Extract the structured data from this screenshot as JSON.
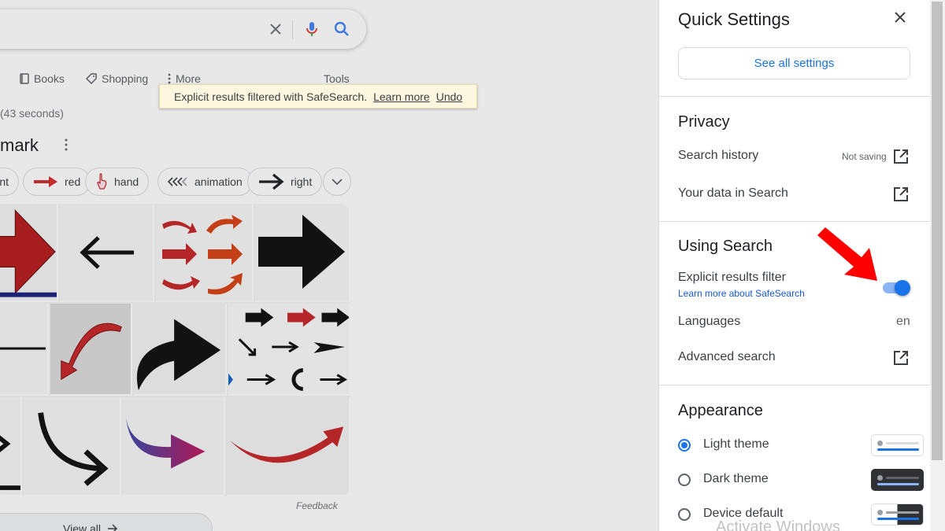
{
  "search": {
    "nav": [
      "Books",
      "Shopping",
      "More",
      "Tools"
    ],
    "results_text": "43 seconds)",
    "heading": "mark"
  },
  "toast": {
    "message": "Explicit results filtered with SafeSearch.",
    "learn_more": "Learn more",
    "undo": "Undo"
  },
  "chips": [
    "nt",
    "red",
    "hand",
    "animation",
    "right"
  ],
  "feedback": "Feedback",
  "view_all": "View all",
  "panel": {
    "title": "Quick Settings",
    "see_all": "See all settings",
    "privacy": {
      "heading": "Privacy",
      "search_history": "Search history",
      "search_history_status": "Not saving",
      "your_data": "Your data in Search"
    },
    "using_search": {
      "heading": "Using Search",
      "explicit_filter": "Explicit results filter",
      "explicit_filter_link": "Learn more about SafeSearch",
      "explicit_filter_on": true,
      "languages": "Languages",
      "language_value": "en",
      "advanced": "Advanced search"
    },
    "appearance": {
      "heading": "Appearance",
      "options": [
        "Light theme",
        "Dark theme",
        "Device default"
      ],
      "selected": "Light theme"
    }
  },
  "watermark": "Activate Windows",
  "colors": {
    "accent": "#1a73e8",
    "annotation": "#ff0000"
  }
}
